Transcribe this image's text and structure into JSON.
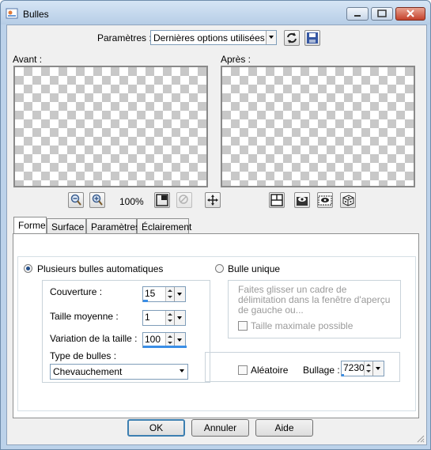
{
  "window": {
    "title": "Bulles"
  },
  "params": {
    "label": "Paramètres :",
    "value": "Dernières options utilisées"
  },
  "labels": {
    "before": "Avant :",
    "after": "Après :",
    "zoom": "100%"
  },
  "tabs": [
    "Forme",
    "Surface",
    "Paramètres",
    "Éclairement"
  ],
  "forme": {
    "auto_label": "Plusieurs bulles automatiques",
    "single_label": "Bulle unique",
    "couverture_label": "Couverture :",
    "couverture_value": "15",
    "taille_label": "Taille moyenne :",
    "taille_value": "1",
    "variation_label": "Variation de la taille :",
    "variation_value": "100",
    "type_label": "Type de bulles :",
    "type_value": "Chevauchement",
    "hint_text": "Faites glisser un cadre de délimitation dans la fenêtre d'aperçu de gauche ou...",
    "max_label": "Taille maximale possible",
    "random_label": "Aléatoire",
    "seed_label": "Bullage :",
    "seed_value": "7230"
  },
  "buttons": {
    "ok": "OK",
    "cancel": "Annuler",
    "help": "Aide"
  }
}
